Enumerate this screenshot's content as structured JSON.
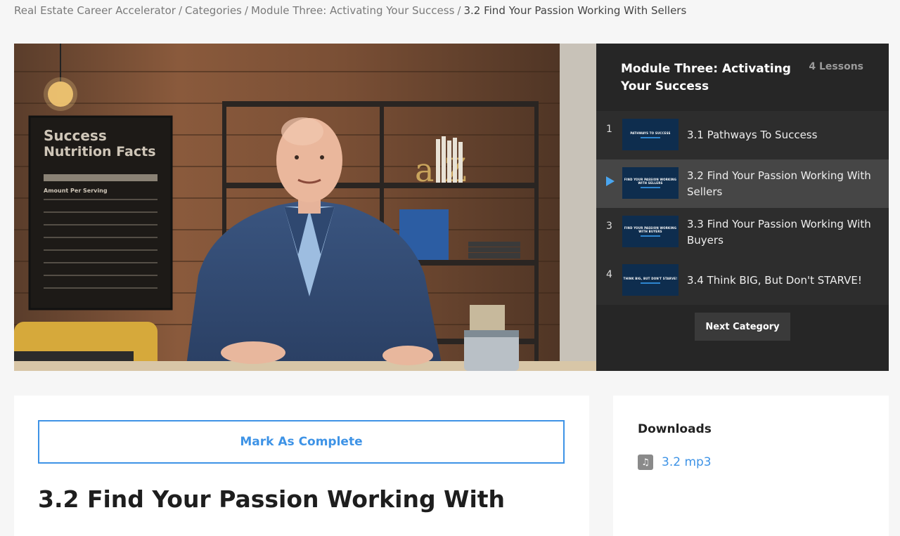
{
  "breadcrumb": {
    "items": [
      "Real Estate Career Accelerator",
      "Categories",
      "Module Three: Activating Your Success"
    ],
    "separator": "/",
    "current": "3.2 Find Your Passion Working With Sellers"
  },
  "video": {
    "poster_texts": {
      "line1": "Success",
      "line2": "Nutrition Facts",
      "serving": "Amount Per Serving"
    },
    "shelf_letters": "a Z"
  },
  "playlist": {
    "module_title": "Module Three: Activating Your Success",
    "lesson_count": "4 Lessons",
    "lessons": [
      {
        "num": "1",
        "thumb_text": "PATHWAYS TO SUCCESS",
        "title": "3.1 Pathways To Success"
      },
      {
        "num": "",
        "thumb_text": "FIND YOUR PASSION WORKING WITH SELLERS",
        "title": "3.2 Find Your Passion Working With Sellers"
      },
      {
        "num": "3",
        "thumb_text": "FIND YOUR PASSION WORKING WITH BUYERS",
        "title": "3.3 Find Your Passion Working With Buyers"
      },
      {
        "num": "4",
        "thumb_text": "THINK BIG, BUT DON'T STARVE!",
        "title": "3.4 Think BIG, But Don't STARVE!"
      }
    ],
    "next_label": "Next Category"
  },
  "main": {
    "complete_label": "Mark As Complete",
    "lesson_title": "3.2 Find Your Passion Working With"
  },
  "downloads": {
    "title": "Downloads",
    "icon": "music-note-icon",
    "file_label": "3.2 mp3"
  },
  "colors": {
    "accent": "#3e93e6",
    "playlist_bg": "#262626",
    "active_lesson": "#464646"
  }
}
